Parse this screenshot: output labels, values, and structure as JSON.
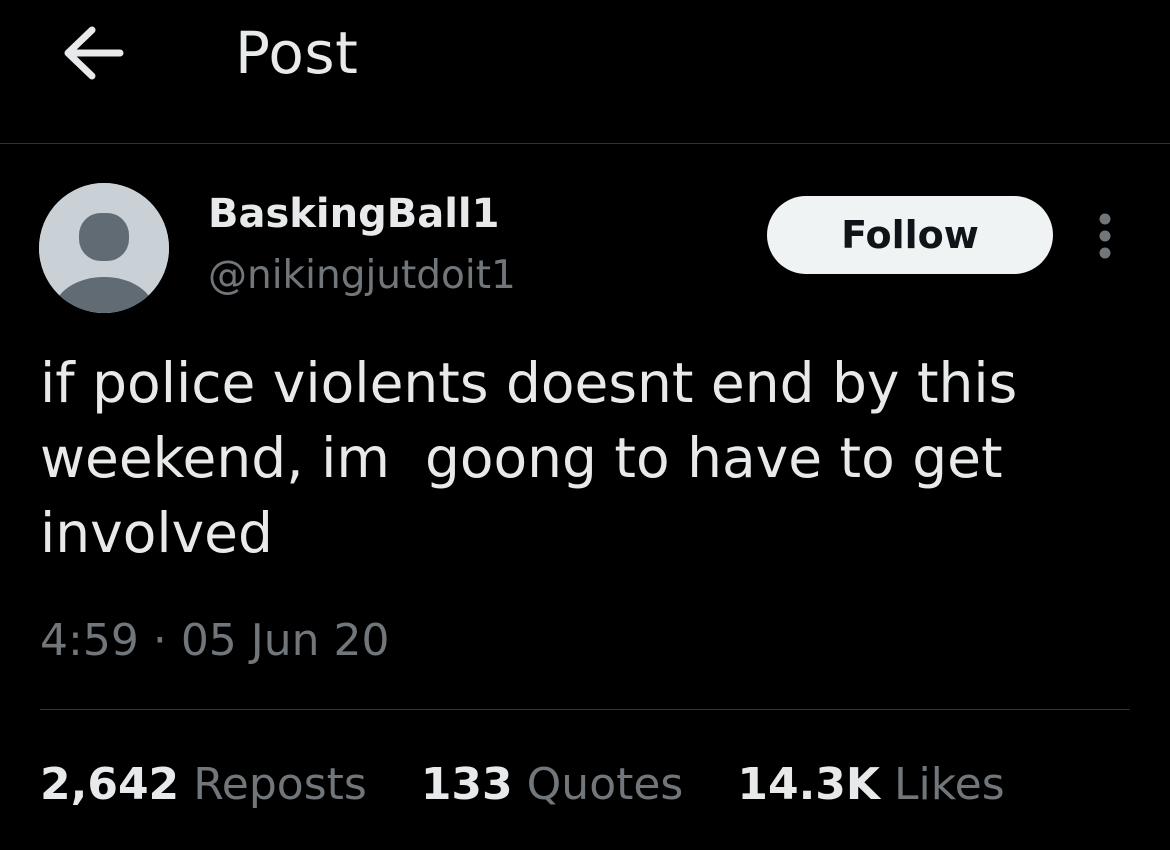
{
  "header": {
    "title": "Post",
    "back_icon": "arrow-left-icon"
  },
  "author": {
    "display_name": "BaskingBall1",
    "handle": "@nikingjutdoit1",
    "avatar_icon": "default-avatar-icon"
  },
  "actions": {
    "follow_label": "Follow",
    "more_icon": "vertical-ellipsis-icon"
  },
  "post": {
    "text": "if police violents doesnt end by this\nweekend, im  goong to have to get\ninvolved",
    "time": "4:59",
    "separator": "·",
    "date": "05 Jun 20"
  },
  "stats": [
    {
      "count": "2,642",
      "label": "Reposts"
    },
    {
      "count": "133",
      "label": "Quotes"
    },
    {
      "count": "14.3K",
      "label": "Likes"
    }
  ],
  "colors": {
    "background": "#000000",
    "primary_text": "#e7e9ea",
    "secondary_text": "#71767b",
    "divider": "#2f3336",
    "follow_button_bg": "#eff3f4",
    "avatar_bg": "#c9d0d6",
    "avatar_figure": "#606b74"
  }
}
